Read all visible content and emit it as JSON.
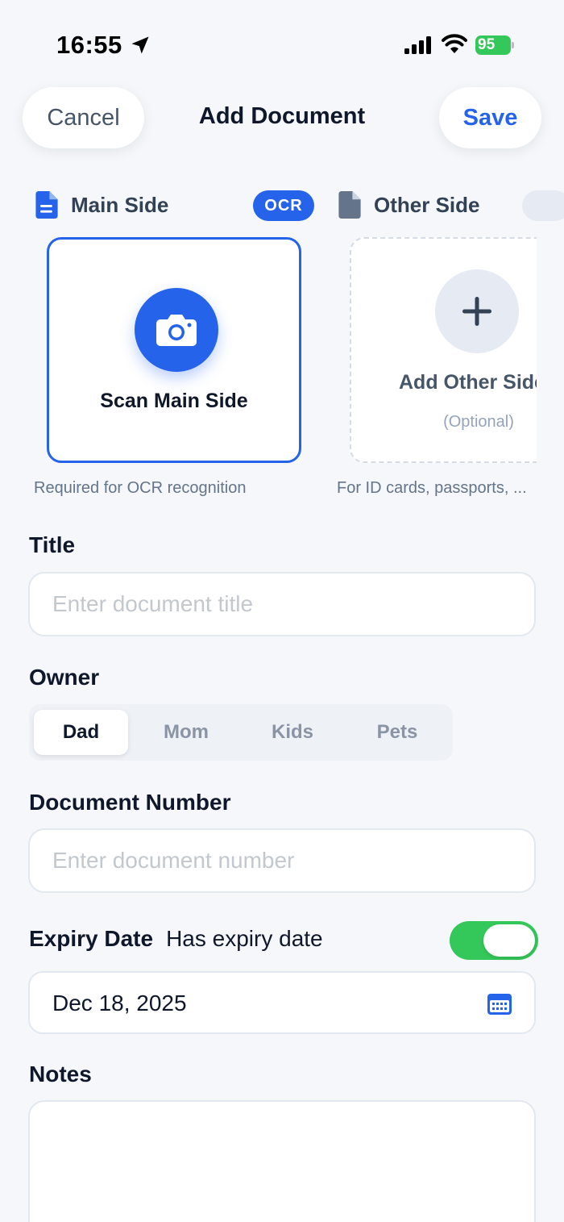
{
  "status_bar": {
    "time": "16:55",
    "battery": "95"
  },
  "nav": {
    "cancel": "Cancel",
    "title": "Add Document",
    "save": "Save"
  },
  "sides": {
    "main": {
      "label": "Main Side",
      "badge": "OCR",
      "action": "Scan Main Side",
      "hint": "Required for OCR recognition"
    },
    "other": {
      "label": "Other Side",
      "action": "Add Other Side",
      "optional": "(Optional)",
      "hint": "For ID cards, passports, ..."
    }
  },
  "form": {
    "title": {
      "label": "Title",
      "placeholder": "Enter document title",
      "value": ""
    },
    "owner": {
      "label": "Owner",
      "options": [
        "Dad",
        "Mom",
        "Kids",
        "Pets"
      ],
      "selected": "Dad"
    },
    "doc_number": {
      "label": "Document Number",
      "placeholder": "Enter document number",
      "value": ""
    },
    "expiry": {
      "label": "Expiry Date",
      "toggle_label": "Has expiry date",
      "enabled": true,
      "date": "Dec 18, 2025"
    },
    "notes": {
      "label": "Notes",
      "value": ""
    }
  },
  "colors": {
    "accent": "#2563EB",
    "toggle_on": "#34C759",
    "background": "#F5F7FA"
  },
  "icons": [
    "location-arrow-icon",
    "cellular-signal-icon",
    "wifi-icon",
    "battery-icon",
    "document-icon",
    "camera-icon",
    "plus-icon",
    "calendar-icon"
  ]
}
